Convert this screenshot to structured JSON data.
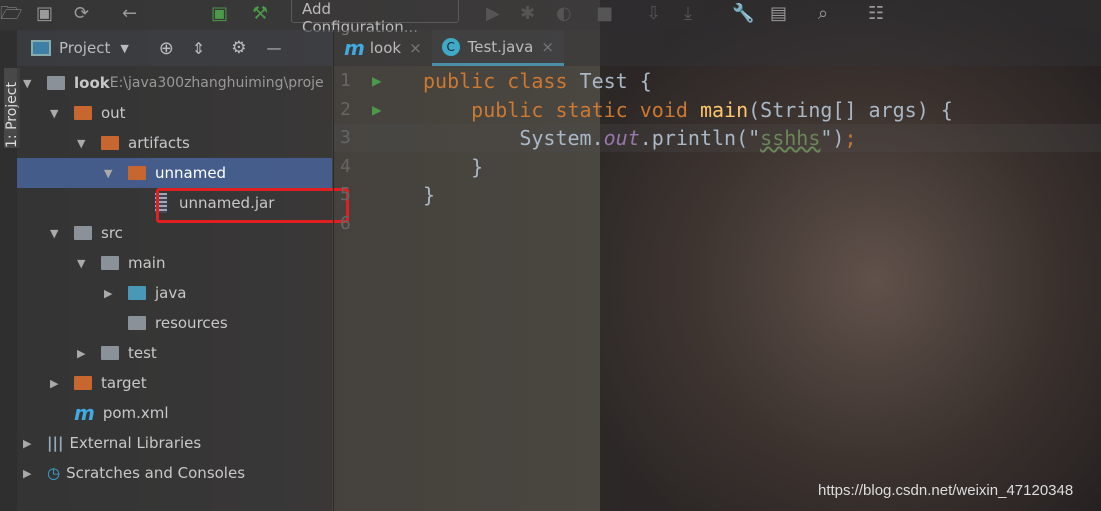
{
  "toolbar": {
    "add_configuration": "Add Configuration...",
    "icons": [
      "open-folder",
      "save",
      "sync",
      "back",
      "run-config",
      "build-hammer",
      "run",
      "debug",
      "coverage",
      "stop",
      "build",
      "update",
      "settings-wrench",
      "project-structure",
      "search",
      "sdk-manager"
    ]
  },
  "side_strip": {
    "label": "1: Project"
  },
  "project_panel": {
    "title": "Project",
    "tree": [
      {
        "label": "look",
        "path": "E:\\java300zhanghuiming\\proje",
        "level": 0,
        "expanded": true,
        "icon": "module-folder"
      },
      {
        "label": "out",
        "level": 1,
        "expanded": true,
        "icon": "folder-orange"
      },
      {
        "label": "artifacts",
        "level": 2,
        "expanded": true,
        "icon": "folder-orange"
      },
      {
        "label": "unnamed",
        "level": 3,
        "expanded": true,
        "icon": "folder-orange",
        "selected": true
      },
      {
        "label": "unnamed.jar",
        "level": 4,
        "icon": "jar-file",
        "highlighted": true
      },
      {
        "label": "src",
        "level": 1,
        "expanded": true,
        "icon": "folder"
      },
      {
        "label": "main",
        "level": 2,
        "expanded": true,
        "icon": "folder"
      },
      {
        "label": "java",
        "level": 3,
        "expanded": false,
        "icon": "source-folder"
      },
      {
        "label": "resources",
        "level": 3,
        "icon": "resources-folder"
      },
      {
        "label": "test",
        "level": 2,
        "expanded": false,
        "icon": "folder"
      },
      {
        "label": "target",
        "level": 1,
        "expanded": false,
        "icon": "folder-orange"
      },
      {
        "label": "pom.xml",
        "level": 1,
        "icon": "maven-file"
      },
      {
        "label": "External Libraries",
        "level": 0,
        "expanded": false,
        "icon": "libraries"
      },
      {
        "label": "Scratches and Consoles",
        "level": 0,
        "expanded": false,
        "icon": "scratches"
      }
    ]
  },
  "editor": {
    "tabs": [
      {
        "label": "look",
        "icon": "maven-m",
        "active": false
      },
      {
        "label": "Test.java",
        "icon": "java-class",
        "active": true
      }
    ],
    "lines": [
      {
        "n": "1",
        "run": true,
        "tokens": [
          [
            "kw",
            "public class "
          ],
          [
            "pl",
            "Test {"
          ]
        ]
      },
      {
        "n": "2",
        "run": true,
        "tokens": [
          [
            "kw",
            "    public static void "
          ],
          [
            "fn",
            "main"
          ],
          [
            "pl",
            "(String[] args) {"
          ]
        ]
      },
      {
        "n": "3",
        "tokens": [
          [
            "pl",
            "        System."
          ],
          [
            "it",
            "out"
          ],
          [
            "pl",
            ".println(\""
          ],
          [
            "st",
            "sshhs"
          ],
          [
            "pl",
            "\")"
          ],
          [
            "kw",
            ";"
          ]
        ]
      },
      {
        "n": "4",
        "tokens": [
          [
            "pl",
            "    }"
          ]
        ]
      },
      {
        "n": "5",
        "tokens": [
          [
            "pl",
            "}"
          ]
        ]
      },
      {
        "n": "6",
        "tokens": []
      }
    ]
  },
  "watermark": "https://blog.csdn.net/weixin_47120348",
  "colors": {
    "selection": "#4b6eaf",
    "highlight_box": "#e02020",
    "keyword": "#cc7832",
    "string": "#6a8759"
  }
}
